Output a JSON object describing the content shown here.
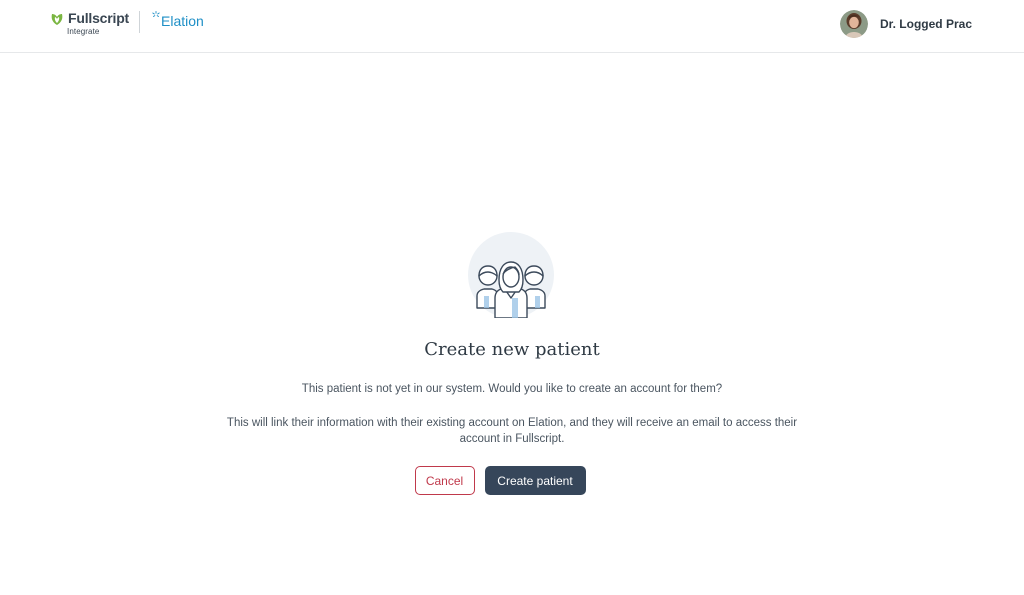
{
  "header": {
    "brand": {
      "name": "Fullscript",
      "subtitle": "Integrate",
      "partner": "Elation",
      "leaf_icon": "fullscript-leaf-icon",
      "partner_icon": "elation-spark-icon",
      "colors": {
        "fullscript_leaf": "#7bb642",
        "elation": "#1e8fc6"
      }
    },
    "user": {
      "name": "Dr. Logged Prac",
      "avatar_icon": "user-avatar"
    }
  },
  "main": {
    "illustration_icon": "people-group-icon",
    "title": "Create new patient",
    "description": "This patient is not yet in our system. Would you like to create an account for them?",
    "details": "This will link their information with their existing account on Elation, and they will receive an email to access their account in Fullscript.",
    "actions": {
      "cancel_label": "Cancel",
      "create_label": "Create patient"
    },
    "colors": {
      "cancel": "#c0394b",
      "primary": "#36465a"
    }
  }
}
